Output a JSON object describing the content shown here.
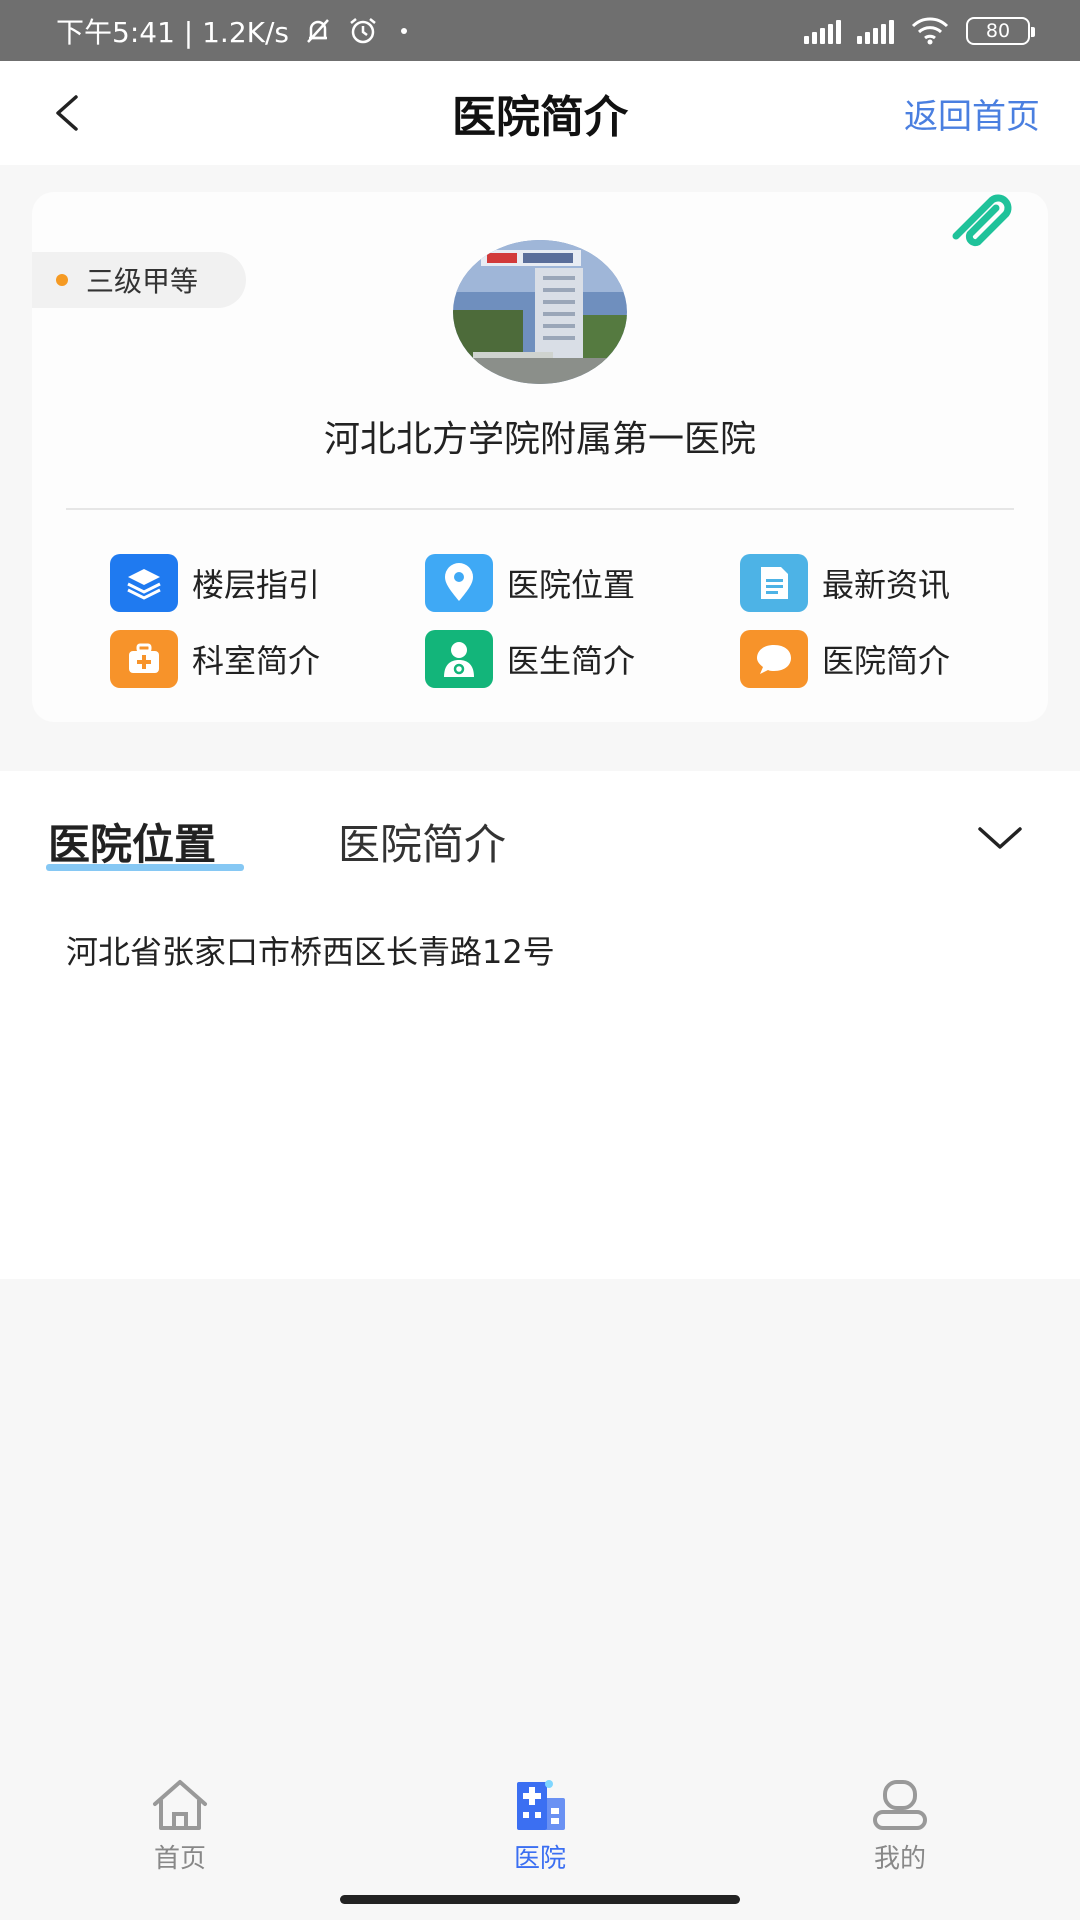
{
  "status_bar": {
    "time_info": "下午5:41 | 1.2K/s",
    "battery": "80"
  },
  "header": {
    "title": "医院简介",
    "home_link": "返回首页"
  },
  "hospital": {
    "grade": "三级甲等",
    "name": "河北北方学院附属第一医院"
  },
  "features": [
    {
      "label": "楼层指引",
      "icon": "layers-icon",
      "color": "#1f7af0"
    },
    {
      "label": "医院位置",
      "icon": "location-pin-icon",
      "color": "#3fa9f5"
    },
    {
      "label": "最新资讯",
      "icon": "document-icon",
      "color": "#4db3e6"
    },
    {
      "label": "科室简介",
      "icon": "medical-kit-icon",
      "color": "#f7932a"
    },
    {
      "label": "医生简介",
      "icon": "doctor-icon",
      "color": "#13b57a"
    },
    {
      "label": "医院简介",
      "icon": "chat-bubble-icon",
      "color": "#f7932a"
    }
  ],
  "tabs": [
    {
      "label": "医院位置",
      "active": true
    },
    {
      "label": "医院简介",
      "active": false
    }
  ],
  "address": "河北省张家口市桥西区长青路12号",
  "bottom_nav": [
    {
      "label": "首页",
      "icon": "home-icon",
      "active": false
    },
    {
      "label": "医院",
      "icon": "hospital-icon",
      "active": true
    },
    {
      "label": "我的",
      "icon": "profile-icon",
      "active": false
    }
  ],
  "colors": {
    "accent_blue": "#4a7fe0",
    "nav_active": "#3b6ff2",
    "grade_dot": "#f59a23",
    "tab_underline": "#86c8f4",
    "clip_green": "#1fc29a"
  }
}
